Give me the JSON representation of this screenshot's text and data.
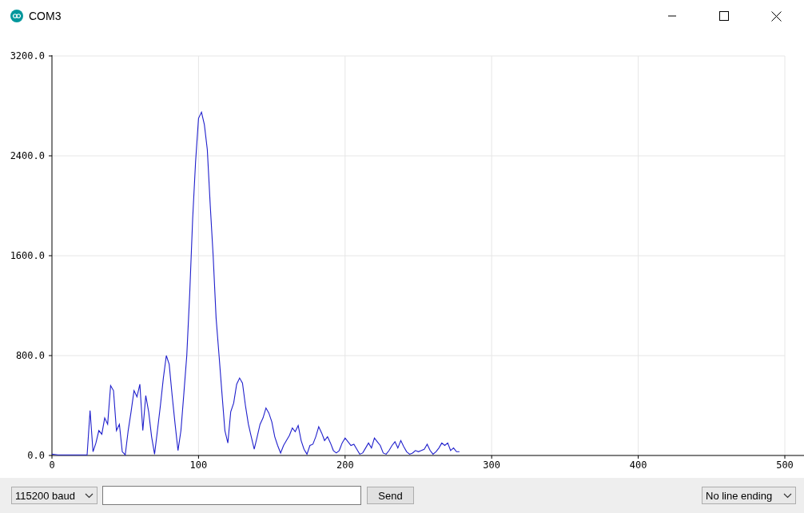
{
  "window": {
    "title": "COM3"
  },
  "plot": {
    "chart_data": {
      "type": "line",
      "grid": true,
      "xlim": [
        0,
        500
      ],
      "ylim": [
        0,
        3200
      ],
      "xticks": [
        0,
        100,
        200,
        300,
        400,
        500
      ],
      "yticks": [
        {
          "value": 0,
          "label": "0.0"
        },
        {
          "value": 800,
          "label": "800.0"
        },
        {
          "value": 1600,
          "label": "1600.0"
        },
        {
          "value": 2400,
          "label": "2400.0"
        },
        {
          "value": 3200,
          "label": "3200.0"
        }
      ],
      "x": [
        0,
        2,
        4,
        6,
        8,
        10,
        12,
        14,
        16,
        18,
        20,
        22,
        24,
        26,
        28,
        30,
        32,
        34,
        36,
        38,
        40,
        42,
        44,
        46,
        48,
        50,
        52,
        54,
        56,
        58,
        60,
        62,
        64,
        66,
        68,
        70,
        72,
        74,
        76,
        78,
        80,
        82,
        84,
        86,
        88,
        90,
        92,
        94,
        96,
        98,
        100,
        102,
        104,
        106,
        108,
        110,
        112,
        114,
        116,
        118,
        120,
        122,
        124,
        126,
        128,
        130,
        132,
        134,
        136,
        138,
        140,
        142,
        144,
        146,
        148,
        150,
        152,
        154,
        156,
        158,
        160,
        162,
        164,
        166,
        168,
        170,
        172,
        174,
        176,
        178,
        180,
        182,
        184,
        186,
        188,
        190,
        192,
        194,
        196,
        198,
        200,
        202,
        204,
        206,
        208,
        210,
        212,
        214,
        216,
        218,
        220,
        222,
        224,
        226,
        228,
        230,
        232,
        234,
        236,
        238,
        240,
        242,
        244,
        246,
        248,
        250,
        252,
        254,
        256,
        258,
        260,
        262,
        264,
        266,
        268,
        270,
        272,
        274,
        276,
        278
      ],
      "series": [
        {
          "color": "#1f1fcc",
          "values": [
            10,
            8,
            5,
            5,
            5,
            5,
            5,
            5,
            5,
            5,
            5,
            5,
            5,
            360,
            30,
            100,
            200,
            170,
            300,
            250,
            560,
            520,
            200,
            250,
            30,
            5,
            200,
            350,
            520,
            470,
            570,
            200,
            480,
            350,
            150,
            10,
            200,
            400,
            620,
            800,
            730,
            480,
            250,
            40,
            200,
            500,
            800,
            1300,
            1900,
            2350,
            2700,
            2750,
            2650,
            2450,
            2000,
            1600,
            1100,
            800,
            500,
            200,
            100,
            350,
            420,
            570,
            620,
            580,
            400,
            250,
            150,
            50,
            150,
            250,
            300,
            380,
            340,
            270,
            150,
            80,
            20,
            80,
            120,
            160,
            220,
            190,
            240,
            120,
            50,
            10,
            80,
            90,
            150,
            230,
            180,
            120,
            150,
            100,
            40,
            20,
            40,
            100,
            140,
            110,
            80,
            90,
            50,
            10,
            20,
            60,
            100,
            60,
            140,
            110,
            80,
            20,
            10,
            40,
            80,
            110,
            60,
            120,
            70,
            30,
            10,
            20,
            40,
            30,
            40,
            50,
            90,
            40,
            10,
            30,
            60,
            100,
            80,
            100,
            40,
            60,
            30,
            30
          ]
        }
      ]
    }
  },
  "bottom_bar": {
    "baud": "115200 baud",
    "send": "Send",
    "line_ending": "No line ending"
  }
}
